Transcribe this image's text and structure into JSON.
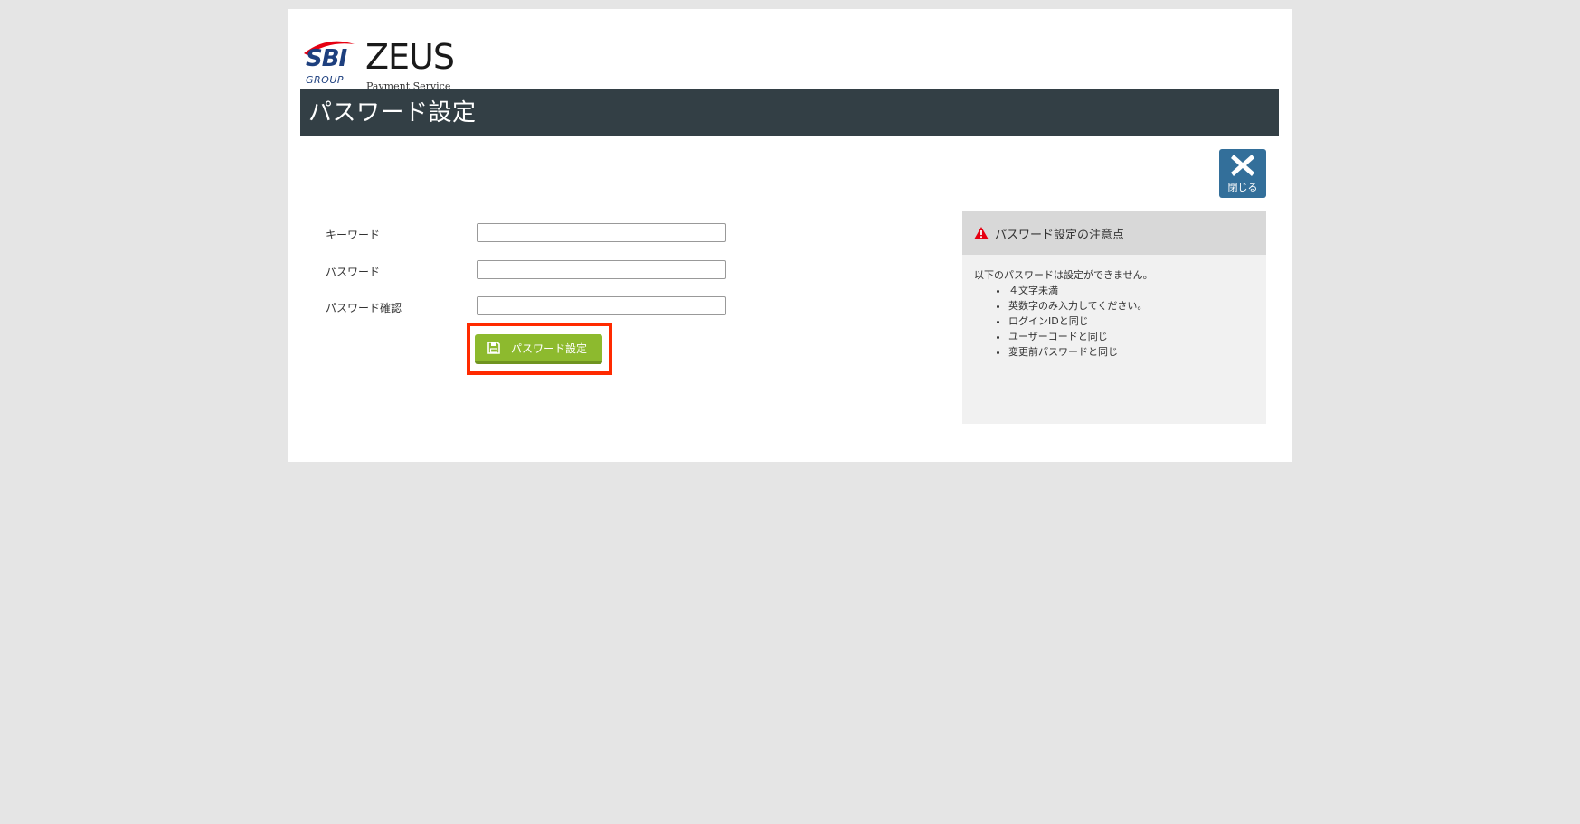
{
  "logo": {
    "brand": "SBI",
    "group": "GROUP",
    "product": "ZEUS",
    "tagline": "Payment Service"
  },
  "header": {
    "title": "パスワード設定"
  },
  "close_button": {
    "icon": "close-icon",
    "label": "閉じる"
  },
  "form": {
    "fields": [
      {
        "label": "キーワード",
        "value": "",
        "placeholder": ""
      },
      {
        "label": "パスワード",
        "value": "",
        "placeholder": ""
      },
      {
        "label": "パスワード確認",
        "value": "",
        "placeholder": ""
      }
    ],
    "submit": {
      "icon": "save-icon",
      "label": "パスワード設定"
    }
  },
  "notice": {
    "icon": "warning-icon",
    "title": "パスワード設定の注意点",
    "intro": "以下のパスワードは設定ができません。",
    "items": [
      "４文字未満",
      "英数字のみ入力してください。",
      "ログインIDと同じ",
      "ユーザーコードと同じ",
      "変更前パスワードと同じ"
    ]
  },
  "colors": {
    "background": "#e5e5e5",
    "title_bar": "#333f45",
    "close_button": "#336f9a",
    "submit_button": "#8dba2e",
    "highlight": "#ff2a00",
    "warning": "#e60012"
  }
}
